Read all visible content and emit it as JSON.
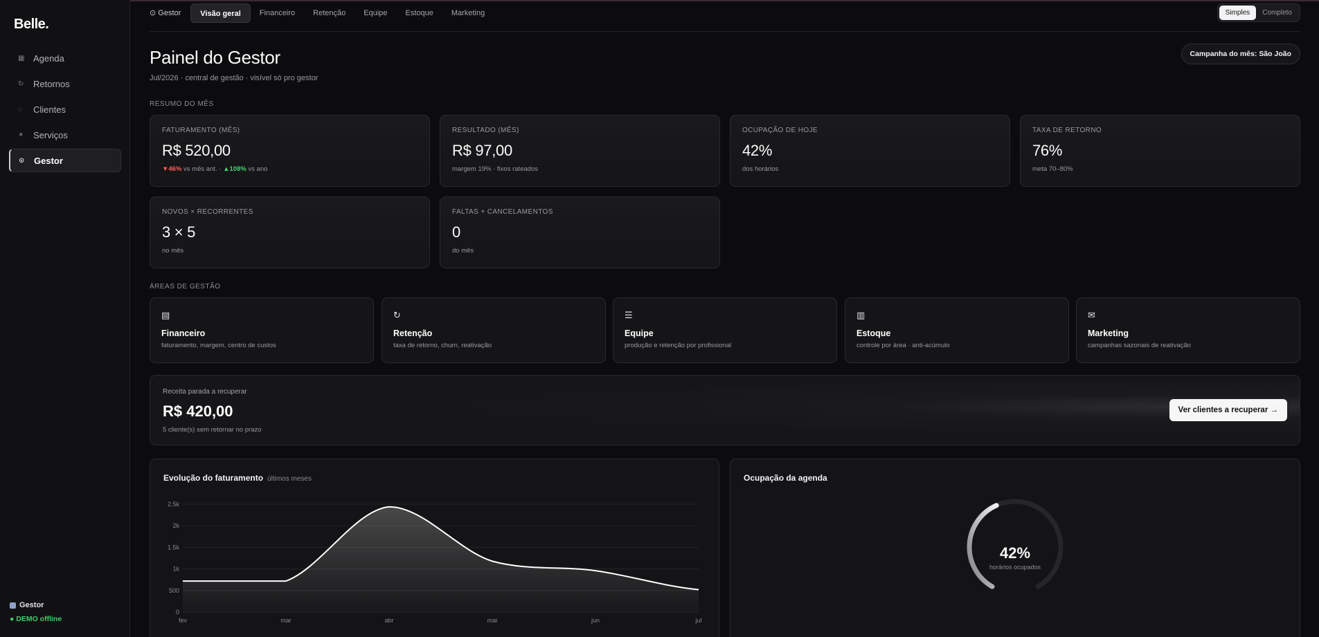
{
  "sidebar": {
    "logo": "Belle.",
    "items": [
      {
        "label": "Agenda",
        "icon": "▦"
      },
      {
        "label": "Retornos",
        "icon": "↻"
      },
      {
        "label": "Clientes",
        "icon": "◌"
      },
      {
        "label": "Serviços",
        "icon": "✶"
      },
      {
        "label": "Gestor",
        "icon": "⊙"
      }
    ],
    "footer": {
      "user": "Gestor",
      "status": "● DEMO offline"
    }
  },
  "tabs": [
    "⊙ Gestor",
    "Visão geral",
    "Financeiro",
    "Retenção",
    "Equipe",
    "Estoque",
    "Marketing"
  ],
  "mode": {
    "simple": "Simples",
    "full": "Completo"
  },
  "header": {
    "title": "Painel do Gestor",
    "subtitle": "Jul/2026 · central de gestão · visível só pro gestor",
    "campaign": "Campanha do mês: São João"
  },
  "summary_label": "RESUMO DO MÊS",
  "kpis": [
    {
      "label": "FATURAMENTO (MÊS)",
      "value": "R$ 520,00",
      "neg": "▼46%",
      "neg_text": " vs mês ant. · ",
      "pos": "▲108%",
      "pos_text": " vs ano"
    },
    {
      "label": "RESULTADO (MÊS)",
      "value": "R$ 97,00",
      "sub": "margem 19% · fixos rateados"
    },
    {
      "label": "OCUPAÇÃO DE HOJE",
      "value": "42%",
      "sub": "dos horários"
    },
    {
      "label": "TAXA DE RETORNO",
      "value": "76%",
      "sub": "meta 70–80%"
    },
    {
      "label": "NOVOS × RECORRENTES",
      "value": "3 × 5",
      "sub": "no mês"
    },
    {
      "label": "FALTAS + CANCELAMENTOS",
      "value": "0",
      "sub": "do mês"
    }
  ],
  "areas_label": "ÁREAS DE GESTÃO",
  "areas": [
    {
      "icon": "▤",
      "name": "Financeiro",
      "desc": "faturamento, margem, centro de custos"
    },
    {
      "icon": "↻",
      "name": "Retenção",
      "desc": "taxa de retorno, churn, reativação"
    },
    {
      "icon": "☰",
      "name": "Equipe",
      "desc": "produção e retenção por profissional"
    },
    {
      "icon": "▥",
      "name": "Estoque",
      "desc": "controle por área · anti-acúmulo"
    },
    {
      "icon": "✉",
      "name": "Marketing",
      "desc": "campanhas sazonais de reativação"
    }
  ],
  "recover": {
    "label": "Receita parada a recuperar",
    "value": "R$ 420,00",
    "sub": "5 cliente(s) sem retornar no prazo",
    "button": "Ver clientes a recuperar →"
  },
  "revenue_panel": {
    "title": "Evolução do faturamento",
    "note": "últimos meses"
  },
  "occupancy_panel": {
    "title": "Ocupação da agenda",
    "value": "42%",
    "caption": "horários ocupados",
    "fraction": 0.42
  },
  "chart_data": {
    "type": "area",
    "title": "Evolução do faturamento",
    "categories": [
      "fev",
      "mar",
      "abr",
      "mai",
      "jun",
      "jul"
    ],
    "series": [
      {
        "values": [
          720,
          720,
          2440,
          1180,
          960,
          520
        ]
      }
    ],
    "ylim": [
      0,
      2500
    ],
    "yticks": [
      "0",
      "500",
      "1k",
      "1.5k",
      "2k",
      "2.5k"
    ],
    "ytick_values": [
      0,
      500,
      1000,
      1500,
      2000,
      2500
    ],
    "grid": true,
    "colors": {
      "line": "#ffffff"
    }
  }
}
